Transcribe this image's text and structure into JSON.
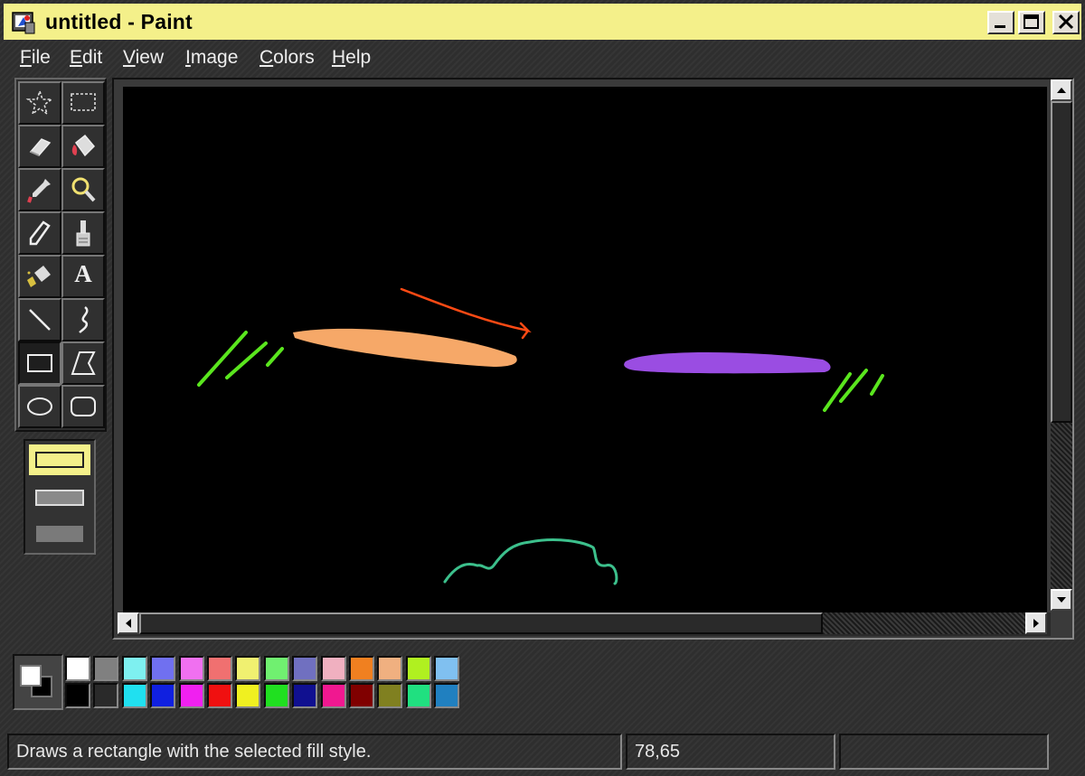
{
  "window": {
    "title": "untitled - Paint"
  },
  "menu": {
    "items": [
      {
        "label": "File",
        "key": "F",
        "rest": "ile"
      },
      {
        "label": "Edit",
        "key": "E",
        "rest": "dit"
      },
      {
        "label": "View",
        "key": "V",
        "rest": "iew"
      },
      {
        "label": "Image",
        "key": "I",
        "rest": "mage"
      },
      {
        "label": "Colors",
        "key": "C",
        "rest": "olors"
      },
      {
        "label": "Help",
        "key": "H",
        "rest": "elp"
      }
    ]
  },
  "tools": [
    {
      "name": "free-form-select",
      "icon": "star-select-icon"
    },
    {
      "name": "select",
      "icon": "rect-select-icon"
    },
    {
      "name": "eraser",
      "icon": "eraser-icon"
    },
    {
      "name": "fill-with-color",
      "icon": "paint-bucket-icon"
    },
    {
      "name": "pick-color",
      "icon": "eyedropper-icon"
    },
    {
      "name": "magnifier",
      "icon": "magnifier-icon"
    },
    {
      "name": "pencil",
      "icon": "pencil-icon"
    },
    {
      "name": "brush",
      "icon": "brush-icon"
    },
    {
      "name": "airbrush",
      "icon": "airbrush-icon"
    },
    {
      "name": "text",
      "icon": "text-icon",
      "text": "A"
    },
    {
      "name": "line",
      "icon": "line-icon"
    },
    {
      "name": "curve",
      "icon": "curve-icon"
    },
    {
      "name": "rectangle",
      "icon": "rectangle-icon",
      "selected": true
    },
    {
      "name": "polygon",
      "icon": "polygon-icon"
    },
    {
      "name": "ellipse",
      "icon": "ellipse-icon"
    },
    {
      "name": "rounded-rectangle",
      "icon": "rounded-rectangle-icon"
    }
  ],
  "fill_styles": [
    {
      "name": "outline-only",
      "selected": true
    },
    {
      "name": "outline-and-fill",
      "selected": false
    },
    {
      "name": "fill-only",
      "selected": false
    }
  ],
  "colors": {
    "foreground": "#ffffff",
    "background": "#000000",
    "palette_top": [
      "#ffffff",
      "#808080",
      "#7ef0f0",
      "#7070f0",
      "#f070f0",
      "#f07070",
      "#f0f070",
      "#70f070",
      "#7070c0",
      "#f0b0c0",
      "#f08020",
      "#f0b080",
      "#b0f020",
      "#80c0f0"
    ],
    "palette_bottom": [
      "#000000",
      "#2a2a2a",
      "#20e0f0",
      "#1020e0",
      "#f020f0",
      "#f01010",
      "#f0f020",
      "#20e020",
      "#101090",
      "#f01890",
      "#800000",
      "#808020",
      "#20e080",
      "#2080c0"
    ]
  },
  "drawing": {
    "strokes": [
      {
        "color": "#5ae61e",
        "shape": "hatch-left"
      },
      {
        "color": "#f6a868",
        "shape": "ellipse-left"
      },
      {
        "color": "#ff4a14",
        "shape": "arrow-curve"
      },
      {
        "color": "#9a4de2",
        "shape": "ellipse-right"
      },
      {
        "color": "#5ae61e",
        "shape": "hatch-right"
      },
      {
        "color": "#3cc08c",
        "shape": "wave-bottom"
      }
    ]
  },
  "status": {
    "message": "Draws a rectangle with the selected fill style.",
    "coords": "78,65",
    "extra": ""
  }
}
